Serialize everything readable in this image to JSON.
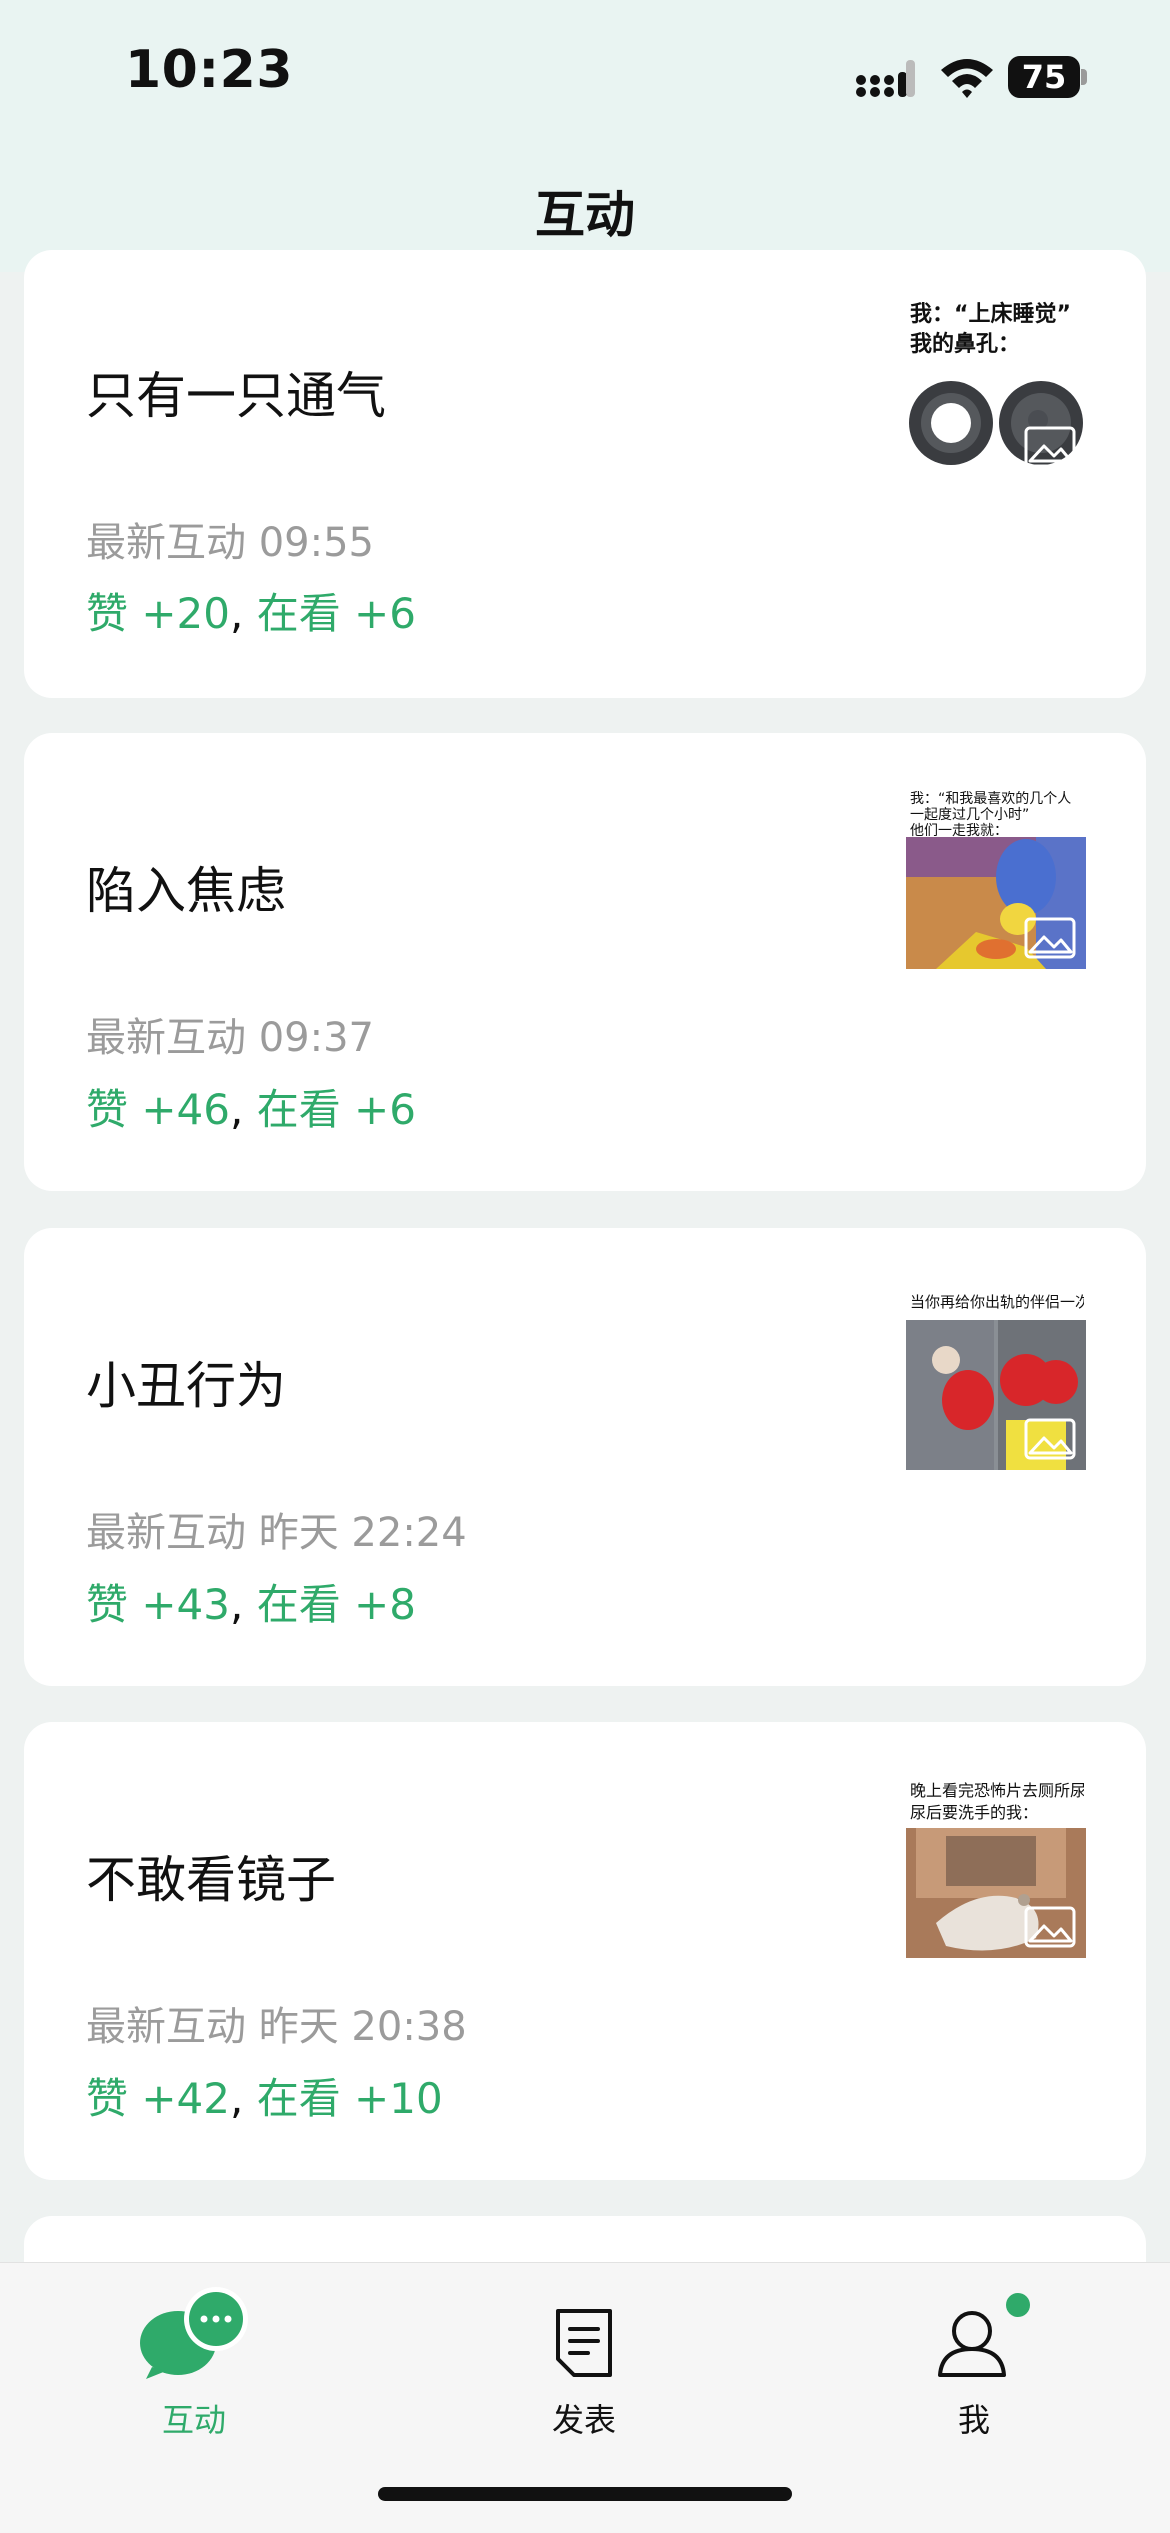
{
  "status": {
    "time": "10:23",
    "battery": "75"
  },
  "header": {
    "title": "互动"
  },
  "cards": [
    {
      "title": "只有一只通气",
      "time": "最新互动 09:55",
      "likes": "赞 +20",
      "sep": ", ",
      "views": "在看 +6",
      "thumb_caption": [
        "我：“上床睡觉”",
        "我的鼻孔："
      ]
    },
    {
      "title": "陷入焦虑",
      "time": "最新互动 09:37",
      "likes": "赞 +46",
      "sep": ", ",
      "views": "在看 +6",
      "thumb_caption": [
        "我：“和我最喜欢的几个人",
        "一起度过几个小时”",
        "他们一走我就："
      ]
    },
    {
      "title": "小丑行为",
      "time": "最新互动 昨天 22:24",
      "likes": "赞 +43",
      "sep": ", ",
      "views": "在看 +8",
      "thumb_caption": [
        "当你再给你出轨的伴侣一次机会"
      ]
    },
    {
      "title": "不敢看镜子",
      "time": "最新互动 昨天 20:38",
      "likes": "赞 +42",
      "sep": ", ",
      "views": "在看 +10",
      "thumb_caption": [
        "晚上看完恐怖片去厕所尿",
        "尿后要洗手的我："
      ]
    }
  ],
  "tabs": [
    {
      "label": "互动",
      "icon": "chat-bubbles-icon",
      "active": true
    },
    {
      "label": "发表",
      "icon": "document-icon",
      "active": false
    },
    {
      "label": "我",
      "icon": "person-icon",
      "active": false
    }
  ],
  "colors": {
    "accent": "#2faa6a",
    "header_bg": "#e9f4f2",
    "page_bg": "#eef2f1"
  }
}
